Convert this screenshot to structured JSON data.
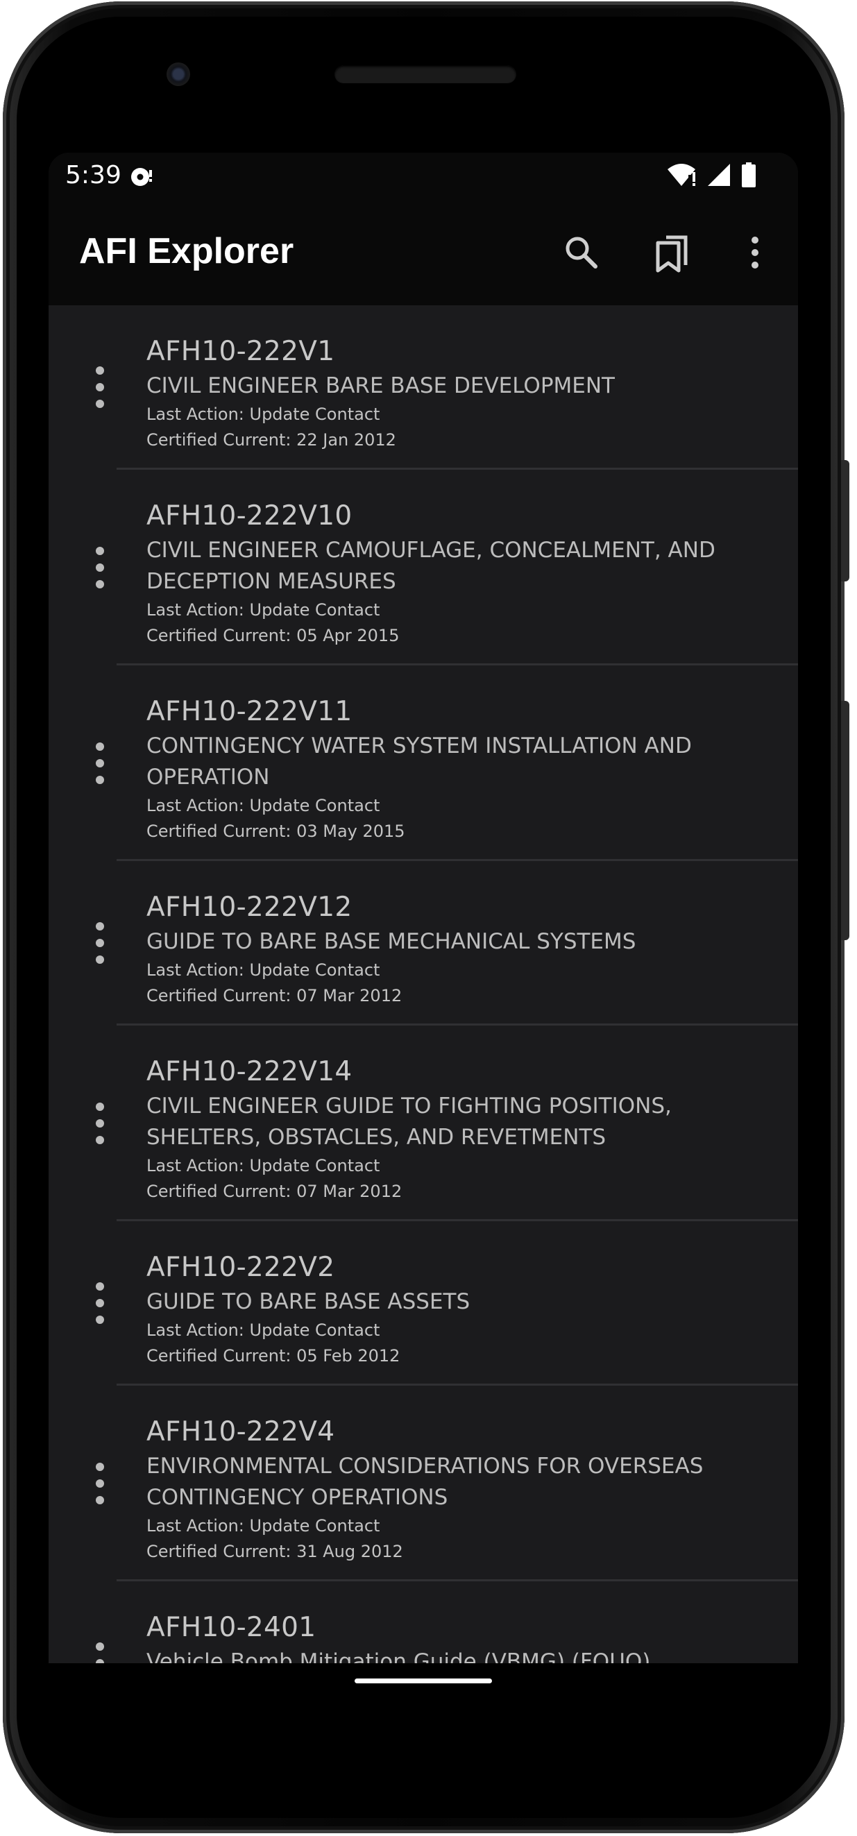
{
  "status_bar": {
    "time": "5:39",
    "left_icon": "sync-indicator-icon",
    "right_icons": [
      "wifi-alert-icon",
      "cellular-signal-icon",
      "battery-full-icon"
    ]
  },
  "app_bar": {
    "title": "AFI Explorer",
    "actions": [
      "search-icon",
      "bookmarks-icon",
      "overflow-menu-icon"
    ]
  },
  "list": [
    {
      "code": "AFH10-222V1",
      "title": "CIVIL ENGINEER BARE BASE DEVELOPMENT",
      "last_action": "Last Action: Update Contact",
      "certified": "Certified Current: 22 Jan 2012"
    },
    {
      "code": "AFH10-222V10",
      "title": "CIVIL ENGINEER CAMOUFLAGE, CONCEALMENT, AND DECEPTION MEASURES",
      "last_action": "Last Action: Update Contact",
      "certified": "Certified Current: 05 Apr 2015"
    },
    {
      "code": "AFH10-222V11",
      "title": "CONTINGENCY WATER SYSTEM INSTALLATION AND OPERATION",
      "last_action": "Last Action: Update Contact",
      "certified": "Certified Current: 03 May 2015"
    },
    {
      "code": "AFH10-222V12",
      "title": "GUIDE TO BARE BASE MECHANICAL SYSTEMS",
      "last_action": "Last Action: Update Contact",
      "certified": "Certified Current: 07 Mar 2012"
    },
    {
      "code": "AFH10-222V14",
      "title": "CIVIL ENGINEER GUIDE TO FIGHTING POSITIONS, SHELTERS, OBSTACLES, AND REVETMENTS",
      "last_action": "Last Action: Update Contact",
      "certified": "Certified Current: 07 Mar 2012"
    },
    {
      "code": "AFH10-222V2",
      "title": "GUIDE TO BARE BASE ASSETS",
      "last_action": "Last Action: Update Contact",
      "certified": "Certified Current: 05 Feb 2012"
    },
    {
      "code": "AFH10-222V4",
      "title": "ENVIRONMENTAL CONSIDERATIONS FOR OVERSEAS CONTINGENCY OPERATIONS",
      "last_action": "Last Action: Update Contact",
      "certified": "Certified Current: 31 Aug 2012"
    },
    {
      "code": "AFH10-2401",
      "title": "Vehicle Bomb Mitigation Guide (VBMG) (FOUO)",
      "last_action": "",
      "certified": ""
    }
  ]
}
